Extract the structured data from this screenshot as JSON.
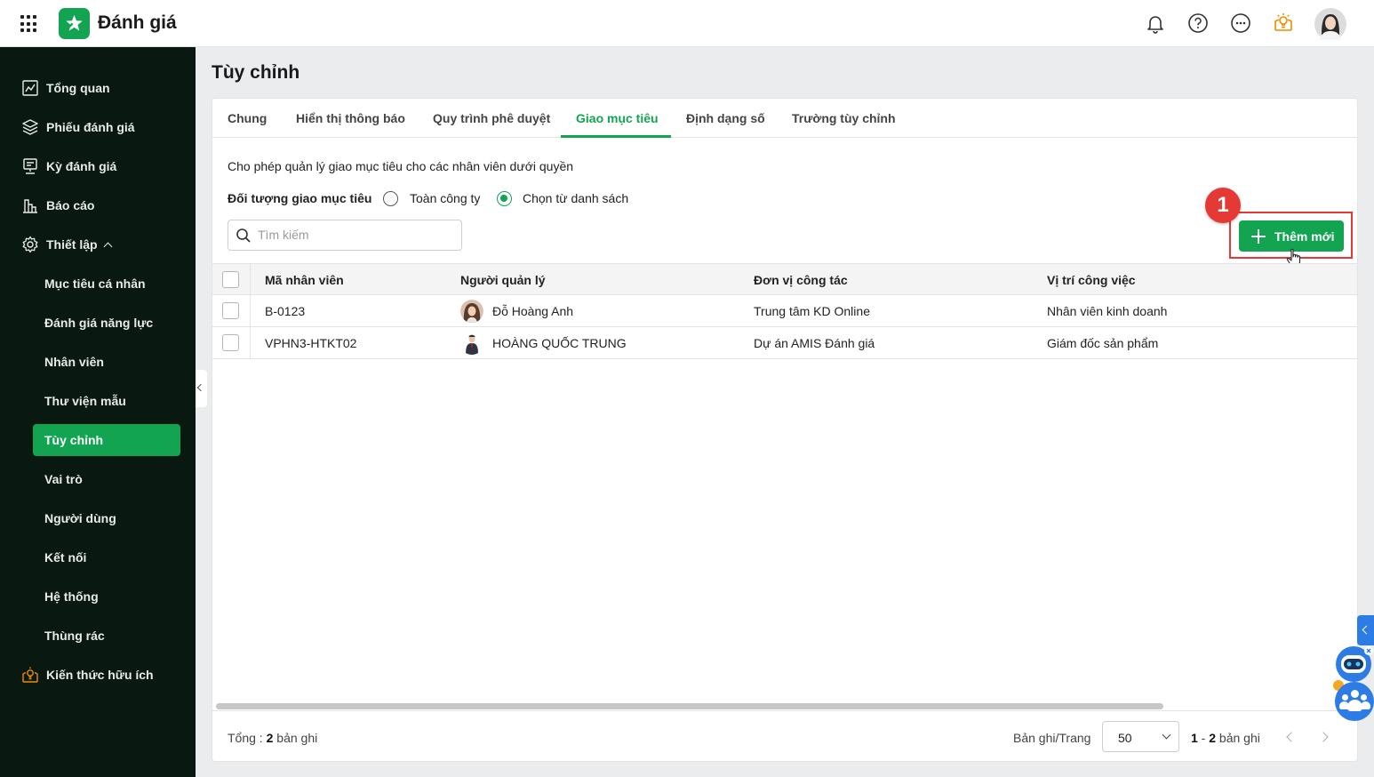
{
  "app": {
    "name": "Đánh giá",
    "brand_color": "#13a452"
  },
  "topbar": {
    "icons": [
      "bell-icon",
      "help-icon",
      "more-icon",
      "knowledge-icon",
      "user-avatar"
    ]
  },
  "sidebar": {
    "items": [
      {
        "label": "Tổng quan",
        "icon": "chart-line-icon"
      },
      {
        "label": "Phiếu đánh giá",
        "icon": "layers-icon"
      },
      {
        "label": "Kỳ đánh giá",
        "icon": "period-icon"
      },
      {
        "label": "Báo cáo",
        "icon": "bar-chart-icon"
      },
      {
        "label": "Thiết lập",
        "icon": "gear-icon",
        "expanded": true
      },
      {
        "label": "Mục tiêu cá nhân"
      },
      {
        "label": "Đánh giá năng lực"
      },
      {
        "label": "Nhân viên"
      },
      {
        "label": "Thư viện mẫu"
      },
      {
        "label": "Tùy chỉnh",
        "active": true
      },
      {
        "label": "Vai trò"
      },
      {
        "label": "Người dùng"
      },
      {
        "label": "Kết nối"
      },
      {
        "label": "Hệ thống"
      },
      {
        "label": "Thùng rác"
      },
      {
        "label": "Kiến thức hữu ích",
        "icon": "lightbulb-icon"
      }
    ]
  },
  "page": {
    "title": "Tùy chỉnh"
  },
  "tabs": [
    {
      "label": "Chung"
    },
    {
      "label": "Hiển thị thông báo"
    },
    {
      "label": "Quy trình phê duyệt"
    },
    {
      "label": "Giao mục tiêu",
      "active": true
    },
    {
      "label": "Định dạng số"
    },
    {
      "label": "Trường tùy chỉnh"
    }
  ],
  "content": {
    "description": "Cho phép quản lý giao mục tiêu cho các nhân viên dưới quyền",
    "assign_label": "Đối tượng giao mục tiêu",
    "options": [
      {
        "label": "Toàn công ty",
        "checked": false
      },
      {
        "label": "Chọn từ danh sách",
        "checked": true
      }
    ],
    "search_placeholder": "Tìm kiếm",
    "add_button": "Thêm mới",
    "step_badge": "1"
  },
  "table": {
    "columns": [
      "Mã nhân viên",
      "Người quản lý",
      "Đơn vị công tác",
      "Vị trí công việc"
    ],
    "rows": [
      [
        "B-0123",
        "Đỗ Hoàng Anh",
        "Trung tâm KD Online",
        "Nhân viên kinh doanh"
      ],
      [
        "VPHN3-HTKT02",
        "HOÀNG QUỐC TRUNG",
        "Dự án AMIS Đánh giá",
        "Giám đốc sản phẩm"
      ]
    ]
  },
  "footer": {
    "total_label": "Tổng : ",
    "total_count": "2",
    "total_suffix": " bản ghi",
    "per_page_label": "Bản ghi/Trang",
    "per_page_value": "50",
    "range_start": "1",
    "range_sep": " - ",
    "range_end": "2",
    "range_suffix": " bản ghi"
  }
}
